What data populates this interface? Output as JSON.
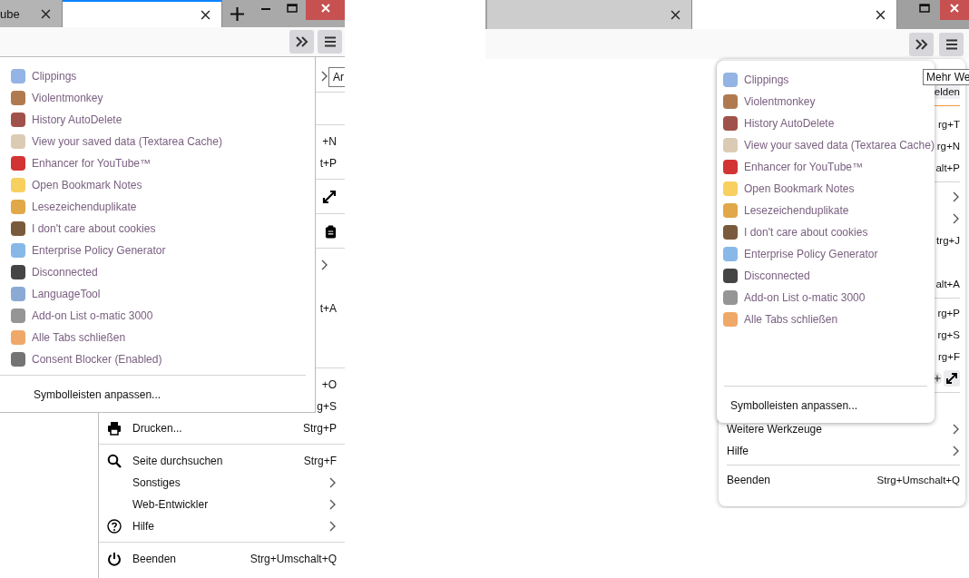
{
  "screens": [
    {
      "tabs": [
        {
          "label": "ube",
          "selected": false
        },
        {
          "selected": true
        }
      ],
      "app_menu": {
        "rows": [
          {
            "kind": "submenu"
          },
          {
            "kind": "separator"
          },
          {
            "kind": "blank"
          },
          {
            "kind": "separator"
          },
          {
            "kind": "shortcut",
            "shortcut": "+N"
          },
          {
            "kind": "shortcut",
            "shortcut": "t+P"
          },
          {
            "kind": "separator"
          },
          {
            "kind": "fullscreen"
          },
          {
            "kind": "separator"
          },
          {
            "kind": "clipboard"
          },
          {
            "kind": "separator"
          },
          {
            "kind": "submenu"
          },
          {
            "kind": "blank"
          },
          {
            "kind": "shortcut",
            "shortcut": "t+A"
          },
          {
            "kind": "blank"
          },
          {
            "kind": "blank"
          },
          {
            "kind": "separator"
          },
          {
            "kind": "shortcut",
            "shortcut": "+O"
          },
          {
            "kind": "shortcut",
            "shortcut": "g+S"
          },
          {
            "kind": "print",
            "label": "Drucken...",
            "shortcut": "Strg+P"
          },
          {
            "kind": "separator"
          },
          {
            "kind": "search",
            "label": "Seite durchsuchen",
            "shortcut": "Strg+F"
          },
          {
            "kind": "item",
            "label": "Sonstiges",
            "submenu": true
          },
          {
            "kind": "item",
            "label": "Web-Entwickler",
            "submenu": true
          },
          {
            "kind": "help",
            "label": "Hilfe",
            "submenu": true
          },
          {
            "kind": "separator"
          },
          {
            "kind": "power",
            "label": "Beenden",
            "shortcut": "Strg+Umschalt+Q"
          }
        ]
      },
      "overflow_menu": {
        "items": [
          {
            "label": "Clippings",
            "color": "#93b4e4"
          },
          {
            "label": "Violentmonkey",
            "color": "#b07a50"
          },
          {
            "label": "History AutoDelete",
            "color": "#a0524a"
          },
          {
            "label": "View your saved data (Textarea Cache)",
            "color": "#dccbb4"
          },
          {
            "label": "Enhancer for YouTube™",
            "color": "#d23434"
          },
          {
            "label": "Open Bookmark Notes",
            "color": "#f8d060"
          },
          {
            "label": "Lesezeichenduplikate",
            "color": "#e0a848"
          },
          {
            "label": "I don't care about cookies",
            "color": "#7a5a3c"
          },
          {
            "label": "Enterprise Policy Generator",
            "color": "#88b8e8"
          },
          {
            "label": "Disconnected",
            "color": "#454545"
          },
          {
            "label": "LanguageTool",
            "color": "#8aaad4"
          },
          {
            "label": "Add-on List o-matic 3000",
            "color": "#959595"
          },
          {
            "label": "Alle Tabs schließen",
            "color": "#f0a868"
          },
          {
            "label": "Consent Blocker (Enabled)",
            "color": "#747474"
          }
        ],
        "customize": "Symbolleisten anpassen..."
      },
      "tooltip": "Ar"
    },
    {
      "tabs": [
        {
          "selected": false
        },
        {
          "selected": true
        }
      ],
      "app_menu": {
        "rows": [
          {
            "kind": "account",
            "label": "elden"
          },
          {
            "kind": "separator",
            "accent": true
          },
          {
            "kind": "shortcut",
            "shortcut": "rg+T"
          },
          {
            "kind": "shortcut",
            "shortcut": "rg+N"
          },
          {
            "kind": "shortcut",
            "shortcut": "alt+P"
          },
          {
            "kind": "separator"
          },
          {
            "kind": "submenu"
          },
          {
            "kind": "submenu"
          },
          {
            "kind": "shortcut",
            "shortcut": "trg+J"
          },
          {
            "kind": "blank"
          },
          {
            "kind": "shortcut",
            "shortcut": "alt+A"
          },
          {
            "kind": "separator"
          },
          {
            "kind": "shortcut",
            "shortcut": "rg+P"
          },
          {
            "kind": "shortcut",
            "shortcut": "rg+S"
          },
          {
            "kind": "shortcut",
            "shortcut": "rg+F"
          },
          {
            "kind": "zoom"
          },
          {
            "kind": "separator"
          },
          {
            "kind": "blank"
          },
          {
            "kind": "item",
            "label": "Weitere Werkzeuge",
            "submenu": true
          },
          {
            "kind": "item",
            "label": "Hilfe",
            "submenu": true
          },
          {
            "kind": "separator"
          },
          {
            "kind": "item",
            "label": "Beenden",
            "shortcut": "Strg+Umschalt+Q"
          }
        ]
      },
      "overflow_menu": {
        "items": [
          {
            "label": "Clippings",
            "color": "#93b4e4"
          },
          {
            "label": "Violentmonkey",
            "color": "#b07a50"
          },
          {
            "label": "History AutoDelete",
            "color": "#a0524a"
          },
          {
            "label": "View your saved data (Textarea Cache)",
            "color": "#dccbb4"
          },
          {
            "label": "Enhancer for YouTube™",
            "color": "#d23434"
          },
          {
            "label": "Open Bookmark Notes",
            "color": "#f8d060"
          },
          {
            "label": "Lesezeichenduplikate",
            "color": "#e0a848"
          },
          {
            "label": "I don't care about cookies",
            "color": "#7a5a3c"
          },
          {
            "label": "Enterprise Policy Generator",
            "color": "#88b8e8"
          },
          {
            "label": "Disconnected",
            "color": "#454545"
          },
          {
            "label": "Add-on List o-matic 3000",
            "color": "#959595"
          },
          {
            "label": "Alle Tabs schließen",
            "color": "#f0a868"
          }
        ],
        "customize": "Symbolleisten anpassen..."
      },
      "tooltip": "Mehr We"
    }
  ]
}
